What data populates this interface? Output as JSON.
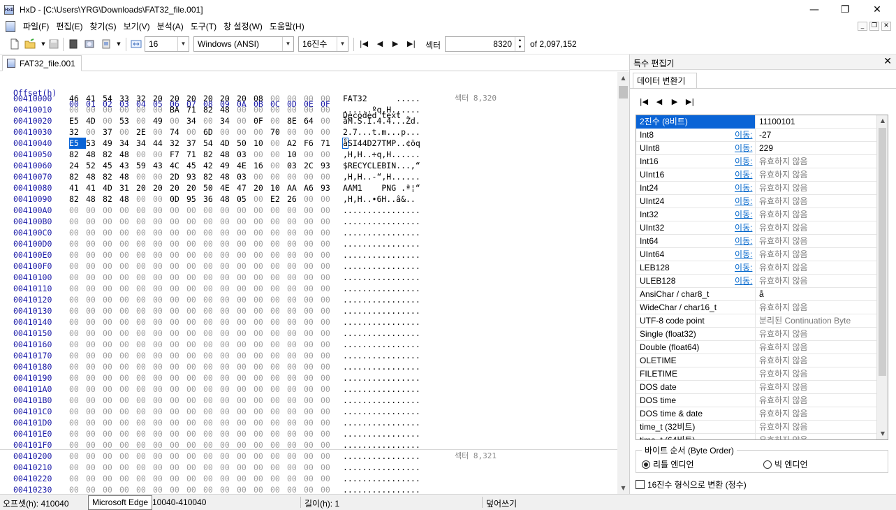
{
  "window": {
    "title": "HxD - [C:\\Users\\YRG\\Downloads\\FAT32_file.001]",
    "minimize": "—",
    "maximize": "❐",
    "close": "✕"
  },
  "menu": [
    "파일(F)",
    "편집(E)",
    "찾기(S)",
    "보기(V)",
    "분석(A)",
    "도구(T)",
    "창 설정(W)",
    "도움말(H)"
  ],
  "mdi_buttons": [
    "_",
    "❐",
    "✕"
  ],
  "toolbar": {
    "bytes_per_row": "16",
    "charset": "Windows (ANSI)",
    "offset_base": "16진수",
    "sector_label": "섹터",
    "sector_value": "8320",
    "sector_total": "of 2,097,152"
  },
  "tab": {
    "label": "FAT32_file.001"
  },
  "hex": {
    "header": {
      "offset": "Offset(h)",
      "columns": [
        "00",
        "01",
        "02",
        "03",
        "04",
        "05",
        "06",
        "07",
        "08",
        "09",
        "0A",
        "0B",
        "0C",
        "0D",
        "0E",
        "0F"
      ],
      "decoded": "Decoded text"
    },
    "selected_offset": "00410040",
    "sector_labels": [
      {
        "row": 0,
        "text": "섹터 8,320"
      },
      {
        "row": 32,
        "text": "섹터 8,321"
      }
    ],
    "rows": [
      {
        "offset": "00410000",
        "bytes": "46 41 54 33 32 20 20 20 20 20 20 08 00 00 00 00",
        "text": "FAT32      ....."
      },
      {
        "offset": "00410010",
        "bytes": "00 00 00 00 00 00 BA 71 82 48 00 00 00 00 00 00",
        "text": "......ºq‚H......"
      },
      {
        "offset": "00410020",
        "bytes": "E5 4D 00 53 00 49 00 34 00 34 00 0F 00 8E 64 00",
        "text": "åM.S.I.4.4...Žd."
      },
      {
        "offset": "00410030",
        "bytes": "32 00 37 00 2E 00 74 00 6D 00 00 00 70 00 00 00",
        "text": "2.7...t.m...p..."
      },
      {
        "offset": "00410040",
        "bytes": "E5 53 49 34 34 44 32 37 54 4D 50 10 00 A2 F6 71",
        "text": "åSI44D27TMP..¢öq"
      },
      {
        "offset": "00410050",
        "bytes": "82 48 82 48 00 00 F7 71 82 48 03 00 00 10 00 00",
        "text": "‚H‚H..÷q‚H......"
      },
      {
        "offset": "00410060",
        "bytes": "24 52 45 43 59 43 4C 45 42 49 4E 16 00 03 2C 93",
        "text": "$RECYCLEBIN...,“"
      },
      {
        "offset": "00410070",
        "bytes": "82 48 82 48 00 00 2D 93 82 48 03 00 00 00 00 00",
        "text": "‚H‚H..-“‚H......"
      },
      {
        "offset": "00410080",
        "bytes": "41 41 4D 31 20 20 20 20 50 4E 47 20 10 AA A6 93",
        "text": "AAM1    PNG .ª¦“"
      },
      {
        "offset": "00410090",
        "bytes": "82 48 82 48 00 00 0D 95 36 48 05 00 E2 26 00 00",
        "text": "‚H‚H..•6H..â&.."
      },
      {
        "offset": "004100A0",
        "bytes": "00 00 00 00 00 00 00 00 00 00 00 00 00 00 00 00",
        "text": "................"
      },
      {
        "offset": "004100B0",
        "bytes": "00 00 00 00 00 00 00 00 00 00 00 00 00 00 00 00",
        "text": "................"
      },
      {
        "offset": "004100C0",
        "bytes": "00 00 00 00 00 00 00 00 00 00 00 00 00 00 00 00",
        "text": "................"
      },
      {
        "offset": "004100D0",
        "bytes": "00 00 00 00 00 00 00 00 00 00 00 00 00 00 00 00",
        "text": "................"
      },
      {
        "offset": "004100E0",
        "bytes": "00 00 00 00 00 00 00 00 00 00 00 00 00 00 00 00",
        "text": "................"
      },
      {
        "offset": "004100F0",
        "bytes": "00 00 00 00 00 00 00 00 00 00 00 00 00 00 00 00",
        "text": "................"
      },
      {
        "offset": "00410100",
        "bytes": "00 00 00 00 00 00 00 00 00 00 00 00 00 00 00 00",
        "text": "................"
      },
      {
        "offset": "00410110",
        "bytes": "00 00 00 00 00 00 00 00 00 00 00 00 00 00 00 00",
        "text": "................"
      },
      {
        "offset": "00410120",
        "bytes": "00 00 00 00 00 00 00 00 00 00 00 00 00 00 00 00",
        "text": "................"
      },
      {
        "offset": "00410130",
        "bytes": "00 00 00 00 00 00 00 00 00 00 00 00 00 00 00 00",
        "text": "................"
      },
      {
        "offset": "00410140",
        "bytes": "00 00 00 00 00 00 00 00 00 00 00 00 00 00 00 00",
        "text": "................"
      },
      {
        "offset": "00410150",
        "bytes": "00 00 00 00 00 00 00 00 00 00 00 00 00 00 00 00",
        "text": "................"
      },
      {
        "offset": "00410160",
        "bytes": "00 00 00 00 00 00 00 00 00 00 00 00 00 00 00 00",
        "text": "................"
      },
      {
        "offset": "00410170",
        "bytes": "00 00 00 00 00 00 00 00 00 00 00 00 00 00 00 00",
        "text": "................"
      },
      {
        "offset": "00410180",
        "bytes": "00 00 00 00 00 00 00 00 00 00 00 00 00 00 00 00",
        "text": "................"
      },
      {
        "offset": "00410190",
        "bytes": "00 00 00 00 00 00 00 00 00 00 00 00 00 00 00 00",
        "text": "................"
      },
      {
        "offset": "004101A0",
        "bytes": "00 00 00 00 00 00 00 00 00 00 00 00 00 00 00 00",
        "text": "................"
      },
      {
        "offset": "004101B0",
        "bytes": "00 00 00 00 00 00 00 00 00 00 00 00 00 00 00 00",
        "text": "................"
      },
      {
        "offset": "004101C0",
        "bytes": "00 00 00 00 00 00 00 00 00 00 00 00 00 00 00 00",
        "text": "................"
      },
      {
        "offset": "004101D0",
        "bytes": "00 00 00 00 00 00 00 00 00 00 00 00 00 00 00 00",
        "text": "................"
      },
      {
        "offset": "004101E0",
        "bytes": "00 00 00 00 00 00 00 00 00 00 00 00 00 00 00 00",
        "text": "................"
      },
      {
        "offset": "004101F0",
        "bytes": "00 00 00 00 00 00 00 00 00 00 00 00 00 00 00 00",
        "text": "................"
      },
      {
        "offset": "00410200",
        "bytes": "00 00 00 00 00 00 00 00 00 00 00 00 00 00 00 00",
        "text": "................"
      },
      {
        "offset": "00410210",
        "bytes": "00 00 00 00 00 00 00 00 00 00 00 00 00 00 00 00",
        "text": "................"
      },
      {
        "offset": "00410220",
        "bytes": "00 00 00 00 00 00 00 00 00 00 00 00 00 00 00 00",
        "text": "................"
      },
      {
        "offset": "00410230",
        "bytes": "00 00 00 00 00 00 00 00 00 00 00 00 00 00 00 00",
        "text": "................"
      }
    ]
  },
  "inspector": {
    "panel_title": "특수 편집기",
    "close": "✕",
    "tab": "데이터 변환기",
    "link_label": "이동:",
    "rows": [
      {
        "name": "2진수 (8비트)",
        "value": "11100101",
        "link": false,
        "na": false,
        "selected": true
      },
      {
        "name": "Int8",
        "value": "-27",
        "link": true,
        "na": false
      },
      {
        "name": "UInt8",
        "value": "229",
        "link": true,
        "na": false
      },
      {
        "name": "Int16",
        "value": "유효하지 않음",
        "link": true,
        "na": true
      },
      {
        "name": "UInt16",
        "value": "유효하지 않음",
        "link": true,
        "na": true
      },
      {
        "name": "Int24",
        "value": "유효하지 않음",
        "link": true,
        "na": true
      },
      {
        "name": "UInt24",
        "value": "유효하지 않음",
        "link": true,
        "na": true
      },
      {
        "name": "Int32",
        "value": "유효하지 않음",
        "link": true,
        "na": true
      },
      {
        "name": "UInt32",
        "value": "유효하지 않음",
        "link": true,
        "na": true
      },
      {
        "name": "Int64",
        "value": "유효하지 않음",
        "link": true,
        "na": true
      },
      {
        "name": "UInt64",
        "value": "유효하지 않음",
        "link": true,
        "na": true
      },
      {
        "name": "LEB128",
        "value": "유효하지 않음",
        "link": true,
        "na": true
      },
      {
        "name": "ULEB128",
        "value": "유효하지 않음",
        "link": true,
        "na": true
      },
      {
        "name": "AnsiChar / char8_t",
        "value": "å",
        "link": false,
        "na": false
      },
      {
        "name": "WideChar / char16_t",
        "value": "유효하지 않음",
        "link": false,
        "na": true
      },
      {
        "name": "UTF-8 code point",
        "value": "분리된 Continuation Byte",
        "link": false,
        "na": true
      },
      {
        "name": "Single (float32)",
        "value": "유효하지 않음",
        "link": false,
        "na": true
      },
      {
        "name": "Double (float64)",
        "value": "유효하지 않음",
        "link": false,
        "na": true
      },
      {
        "name": "OLETIME",
        "value": "유효하지 않음",
        "link": false,
        "na": true
      },
      {
        "name": "FILETIME",
        "value": "유효하지 않음",
        "link": false,
        "na": true
      },
      {
        "name": "DOS date",
        "value": "유효하지 않음",
        "link": false,
        "na": true
      },
      {
        "name": "DOS time",
        "value": "유효하지 않음",
        "link": false,
        "na": true
      },
      {
        "name": "DOS time & date",
        "value": "유효하지 않음",
        "link": false,
        "na": true
      },
      {
        "name": "time_t (32비트)",
        "value": "유효하지 않음",
        "link": false,
        "na": true
      },
      {
        "name": "time_t (64비트)",
        "value": "유효하지 않음",
        "link": false,
        "na": true
      }
    ],
    "byte_order": {
      "title": "바이트 순서 (Byte Order)",
      "little": "리틀 엔디언",
      "big": "빅 엔디언",
      "selected": "little"
    },
    "hex_integer_option": "16진수 형식으로 변환 (정수)"
  },
  "status": {
    "offset": "오프셋(h): 410040",
    "block": "10040-410040",
    "length": "길이(h): 1",
    "mode": "덮어쓰기",
    "tooltip": "Microsoft Edge"
  }
}
